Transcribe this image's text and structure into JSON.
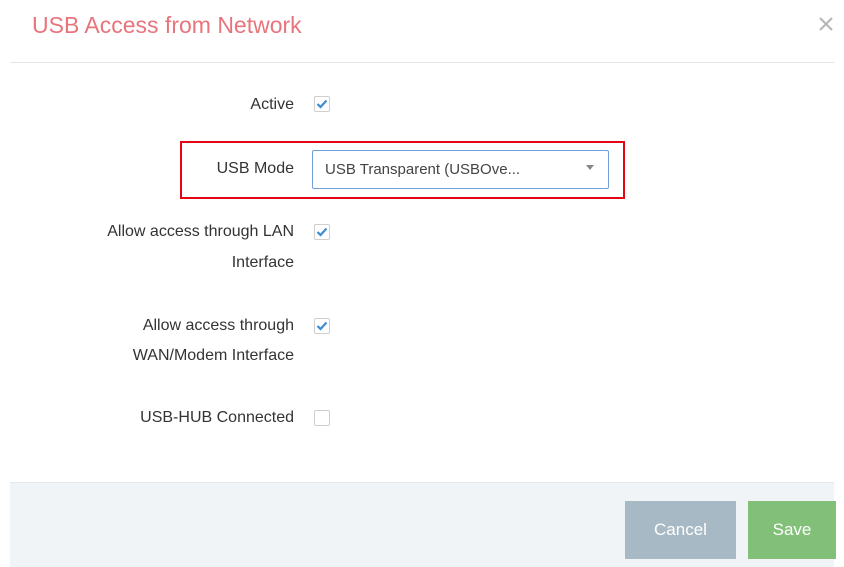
{
  "dialog": {
    "title": "USB Access from Network",
    "colors": {
      "title": "#e8747c",
      "checkmark": "#3b8ed4",
      "cancel_button": "#a7b9c4",
      "save_button": "#82c07a",
      "highlight_border": "#e30613"
    }
  },
  "form": {
    "active": {
      "label": "Active",
      "checked": true
    },
    "usb_mode": {
      "label": "USB Mode",
      "value": "USB Transparent (USBOve..."
    },
    "allow_lan": {
      "label_line1": "Allow access through LAN",
      "label_line2": "Interface",
      "checked": true
    },
    "allow_wan": {
      "label_line1": "Allow access through",
      "label_line2": "WAN/Modem Interface",
      "checked": true
    },
    "usb_hub": {
      "label": "USB-HUB Connected",
      "checked": false
    }
  },
  "footer": {
    "cancel_label": "Cancel",
    "save_label": "Save"
  }
}
